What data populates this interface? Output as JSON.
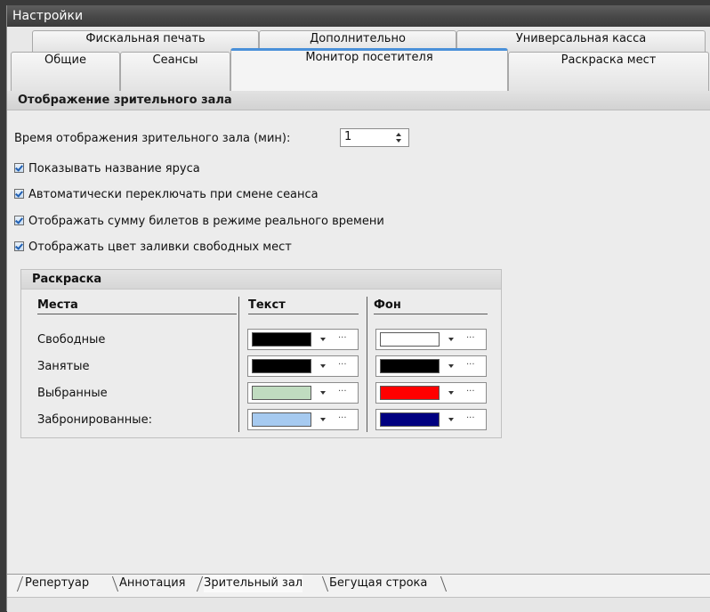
{
  "window": {
    "title": "Настройки"
  },
  "tabs": {
    "row1": [
      "Фискальная печать",
      "Дополнительно",
      "Универсальная касса"
    ],
    "row2": [
      "Общие",
      "Сеансы",
      "Монитор посетителя",
      "Раскраска мест"
    ],
    "active": "Монитор посетителя"
  },
  "section": {
    "title": "Отображение зрительного зала",
    "time_label": "Время отображения зрительного зала (мин):",
    "time_value": "1",
    "checkboxes": [
      {
        "label": "Показывать название яруса",
        "checked": true
      },
      {
        "label": "Автоматически переключать при смене сеанса",
        "checked": true
      },
      {
        "label": "Отображать сумму билетов в режиме реального времени",
        "checked": true
      },
      {
        "label": "Отображать цвет заливки свободных мест",
        "checked": true
      }
    ]
  },
  "coloring": {
    "title": "Раскраска",
    "headers": {
      "places": "Места",
      "text": "Текст",
      "background": "Фон"
    },
    "rows": [
      {
        "label": "Свободные",
        "text_color": "#000000",
        "bg_color": "#ffffff"
      },
      {
        "label": "Занятые",
        "text_color": "#000000",
        "bg_color": "#000000"
      },
      {
        "label": "Выбранные",
        "text_color": "#c0dcc0",
        "bg_color": "#ff0000"
      },
      {
        "label": "Забронированные:",
        "text_color": "#a6caf0",
        "bg_color": "#000080"
      }
    ],
    "ellipsis": "···"
  },
  "bottom_tabs": {
    "items": [
      "Репертуар",
      "Аннотация",
      "Зрительный зал",
      "Бегущая строка"
    ],
    "active": "Зрительный зал"
  },
  "colors": {
    "accent": "#4a90d9",
    "titlebar": "#474747"
  }
}
